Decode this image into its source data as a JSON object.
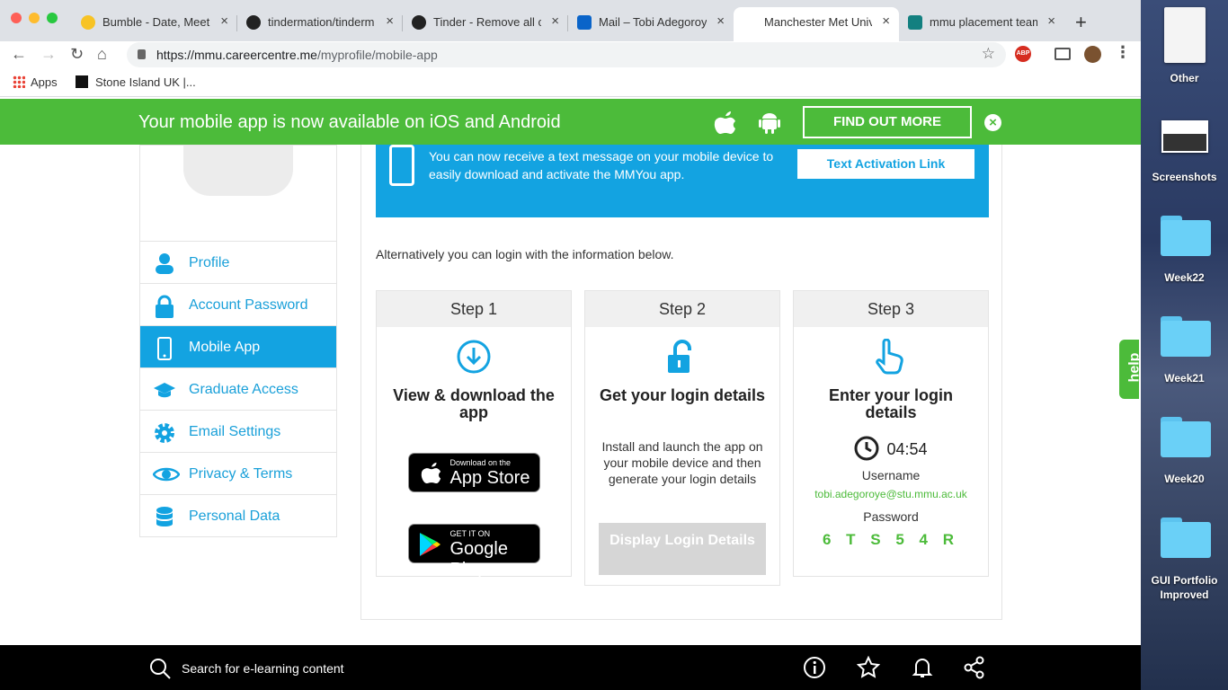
{
  "browser": {
    "tabs": [
      {
        "title": "Bumble - Date, Meet,",
        "favicon_color": "#f7c325"
      },
      {
        "title": "tindermation/tinderm",
        "favicon_color": "#222222"
      },
      {
        "title": "Tinder - Remove all c",
        "favicon_color": "#222222"
      },
      {
        "title": "Mail – Tobi Adegoroy",
        "favicon_color": "#0a64c9"
      },
      {
        "title": "Manchester Met Univ",
        "favicon_color": "#ffffff"
      },
      {
        "title": "mmu placement team",
        "favicon_color": "#138080"
      }
    ],
    "active_tab_index": 4,
    "url_domain": "https://mmu.careercentre.me",
    "url_path": "/myprofile/mobile-app",
    "bookmarks": [
      "Apps",
      "Stone Island UK |..."
    ],
    "extension_badge": "ABP"
  },
  "banner": {
    "message": "Your mobile app is now available on iOS and Android",
    "button": "FIND OUT MORE",
    "bg_color": "#4cbb3a"
  },
  "sidebar": {
    "items": [
      {
        "label": "Profile",
        "icon": "person-icon"
      },
      {
        "label": "Account Password",
        "icon": "lock-icon"
      },
      {
        "label": "Mobile App",
        "icon": "phone-icon",
        "active": true
      },
      {
        "label": "Graduate Access",
        "icon": "mortarboard-icon"
      },
      {
        "label": "Email Settings",
        "icon": "gear-icon"
      },
      {
        "label": "Privacy & Terms",
        "icon": "eye-icon"
      },
      {
        "label": "Personal Data",
        "icon": "database-icon"
      }
    ],
    "accent": "#13a3e1"
  },
  "main": {
    "sms_message": "You can now receive a text message on your mobile device to easily download and activate the MMYou app.",
    "sms_button": "Text Activation Link",
    "alt_text": "Alternatively you can login with the information below.",
    "steps": [
      {
        "head": "Step 1",
        "title": "View & download the app",
        "appstore_small": "Download on the",
        "appstore_big": "App Store",
        "play_small": "GET IT ON",
        "play_big": "Google Play"
      },
      {
        "head": "Step 2",
        "title": "Get your login details",
        "desc": "Install and launch the app on your mobile device and then generate your login details",
        "button": "Display Login Details"
      },
      {
        "head": "Step 3",
        "title": "Enter your login details",
        "timer": "04:54",
        "username_label": "Username",
        "username": "tobi.adegoroye@stu.mmu.ac.uk",
        "password_label": "Password",
        "password": "6 T S 5 4 R"
      }
    ]
  },
  "help_tab": "help",
  "bottom_bar": {
    "search_text": "Search for e-learning content"
  },
  "desktop": {
    "items": [
      "Other",
      "Screenshots",
      "Week22",
      "Week21",
      "Week20",
      "GUI Portfolio Improved"
    ]
  }
}
